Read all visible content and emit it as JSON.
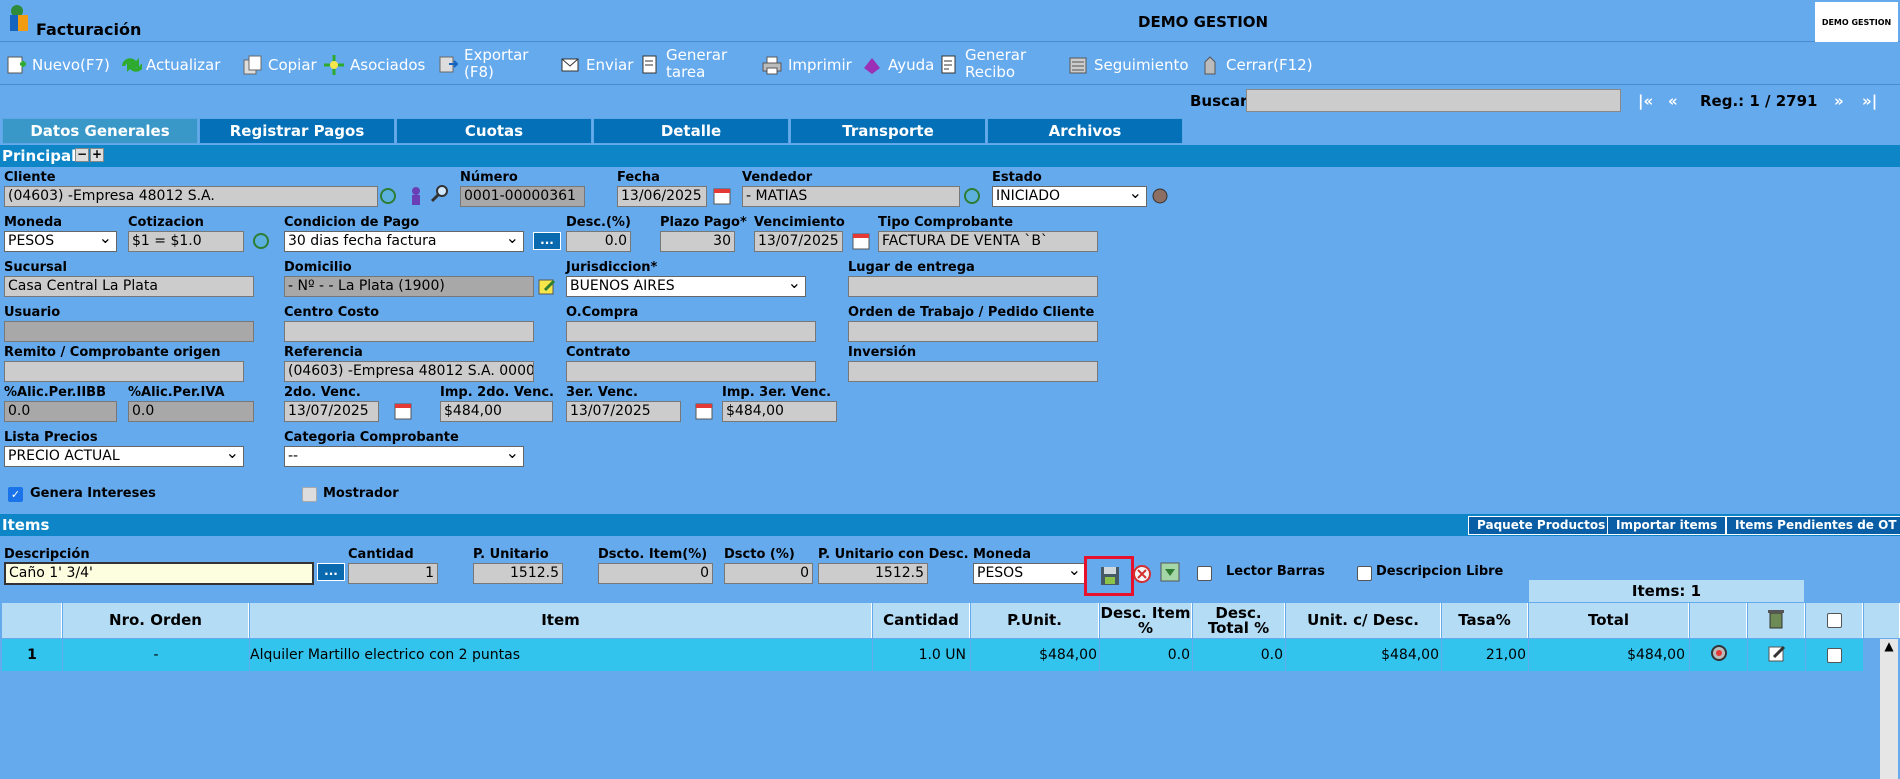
{
  "app": {
    "title": "Facturación",
    "company": "DEMO GESTION",
    "logo_text": "DEMO GESTION"
  },
  "toolbar": [
    {
      "label": "Nuevo(F7)",
      "icon": "new-icon"
    },
    {
      "label": "Actualizar",
      "icon": "refresh-icon"
    },
    {
      "label": "Copiar",
      "icon": "copy-icon"
    },
    {
      "label": "Asociados",
      "icon": "associated-icon"
    },
    {
      "label": "Exportar (F8)",
      "icon": "export-icon"
    },
    {
      "label": "Enviar",
      "icon": "send-icon"
    },
    {
      "label": "Generar tarea",
      "icon": "task-icon"
    },
    {
      "label": "Imprimir",
      "icon": "print-icon"
    },
    {
      "label": "Ayuda",
      "icon": "help-icon"
    },
    {
      "label": "Generar Recibo",
      "icon": "receipt-icon"
    },
    {
      "label": "Seguimiento",
      "icon": "tracking-icon"
    },
    {
      "label": "Cerrar(F12)",
      "icon": "close-icon"
    }
  ],
  "search": {
    "label": "Buscar",
    "value": "",
    "first": "|«",
    "prev": "«",
    "record": "Reg.: 1 / 2791",
    "next": "»",
    "last": "»|"
  },
  "tabs": [
    "Datos Generales",
    "Registrar Pagos",
    "Cuotas",
    "Detalle",
    "Transporte",
    "Archivos"
  ],
  "principal": {
    "title": "Principal"
  },
  "fields": {
    "cliente": {
      "label": "Cliente",
      "value": "(04603) -Empresa 48012 S.A."
    },
    "numero": {
      "label": "Número",
      "value": "0001-00000361"
    },
    "fecha": {
      "label": "Fecha",
      "value": "13/06/2025"
    },
    "vendedor": {
      "label": "Vendedor",
      "value": "- MATIAS"
    },
    "estado": {
      "label": "Estado",
      "value": "INICIADO"
    },
    "moneda": {
      "label": "Moneda",
      "value": "PESOS"
    },
    "cotizacion": {
      "label": "Cotizacion",
      "value": "$1 = $1.0"
    },
    "condicion": {
      "label": "Condicion de Pago",
      "value": "30 dias fecha factura"
    },
    "desc": {
      "label": "Desc.(%)",
      "value": "0.0"
    },
    "plazo": {
      "label": "Plazo Pago*",
      "value": "30"
    },
    "vencimiento": {
      "label": "Vencimiento",
      "value": "13/07/2025"
    },
    "tipo": {
      "label": "Tipo Comprobante",
      "value": "FACTURA DE VENTA `B`"
    },
    "sucursal": {
      "label": "Sucursal",
      "value": "Casa Central La Plata"
    },
    "domicilio": {
      "label": "Domicilio",
      "value": "- Nº - - La Plata (1900)"
    },
    "jurisdiccion": {
      "label": "Jurisdiccion*",
      "value": "BUENOS AIRES"
    },
    "lugar": {
      "label": "Lugar de entrega",
      "value": ""
    },
    "usuario": {
      "label": "Usuario",
      "value": ""
    },
    "centro": {
      "label": "Centro Costo",
      "value": ""
    },
    "ocompra": {
      "label": "O.Compra",
      "value": ""
    },
    "orden": {
      "label": "Orden de Trabajo / Pedido Cliente",
      "value": ""
    },
    "remito": {
      "label": "Remito / Comprobante origen",
      "value": ""
    },
    "referencia": {
      "label": "Referencia",
      "value": "(04603) -Empresa 48012 S.A. 0000"
    },
    "contrato": {
      "label": "Contrato",
      "value": ""
    },
    "inversion": {
      "label": "Inversión",
      "value": ""
    },
    "iibb": {
      "label": "%Alic.Per.IIBB",
      "value": "0.0"
    },
    "iva": {
      "label": "%Alic.Per.IVA",
      "value": "0.0"
    },
    "venc2": {
      "label": "2do. Venc.",
      "value": "13/07/2025"
    },
    "imp2": {
      "label": "Imp. 2do. Venc.",
      "value": "$484,00"
    },
    "venc3": {
      "label": "3er. Venc.",
      "value": "13/07/2025"
    },
    "imp3": {
      "label": "Imp. 3er. Venc.",
      "value": "$484,00"
    },
    "lista": {
      "label": "Lista Precios",
      "value": "PRECIO ACTUAL"
    },
    "categoria": {
      "label": "Categoria Comprobante",
      "value": "--"
    },
    "genera": {
      "label": "Genera Intereses",
      "checked": true
    },
    "mostrador": {
      "label": "Mostrador",
      "checked": false
    }
  },
  "items_section": {
    "title": "Items",
    "buttons": [
      "Paquete Productos",
      "Importar items",
      "Items Pendientes de OT"
    ],
    "descripcion": {
      "label": "Descripción",
      "value": "Caño  1' 3/4'"
    },
    "cantidad": {
      "label": "Cantidad",
      "value": "1"
    },
    "punitario": {
      "label": "P. Unitario",
      "value": "1512.5"
    },
    "dscto_item": {
      "label": "Dscto. Item(%)",
      "value": "0"
    },
    "dscto": {
      "label": "Dscto (%)",
      "value": "0"
    },
    "pu_desc": {
      "label": "P. Unitario con Desc.",
      "value": "1512.5"
    },
    "moneda": {
      "label": "Moneda",
      "value": "PESOS"
    },
    "lector": {
      "label": "Lector Barras"
    },
    "desc_libre": {
      "label": "Descripcion Libre"
    },
    "items_count": "Items: 1"
  },
  "grid": {
    "headers": [
      "",
      "Nro. Orden",
      "Item",
      "Cantidad",
      "P.Unit.",
      "Desc. Item %",
      "Desc. Total %",
      "Unit. c/ Desc.",
      "Tasa%",
      "Total"
    ],
    "rows": [
      {
        "idx": "1",
        "orden": "-",
        "item": "Alquiler Martillo electrico con 2 puntas",
        "cantidad": "1.0 UN",
        "punit": "$484,00",
        "desc_item": "0.0",
        "desc_total": "0.0",
        "unit_desc": "$484,00",
        "tasa": "21,00",
        "total": "$484,00"
      }
    ]
  },
  "colors": {
    "background": "#66aaee",
    "tab": "#0470b8",
    "section": "#0e85c6",
    "row": "#33c4ee",
    "highlight": "#e8102a"
  }
}
